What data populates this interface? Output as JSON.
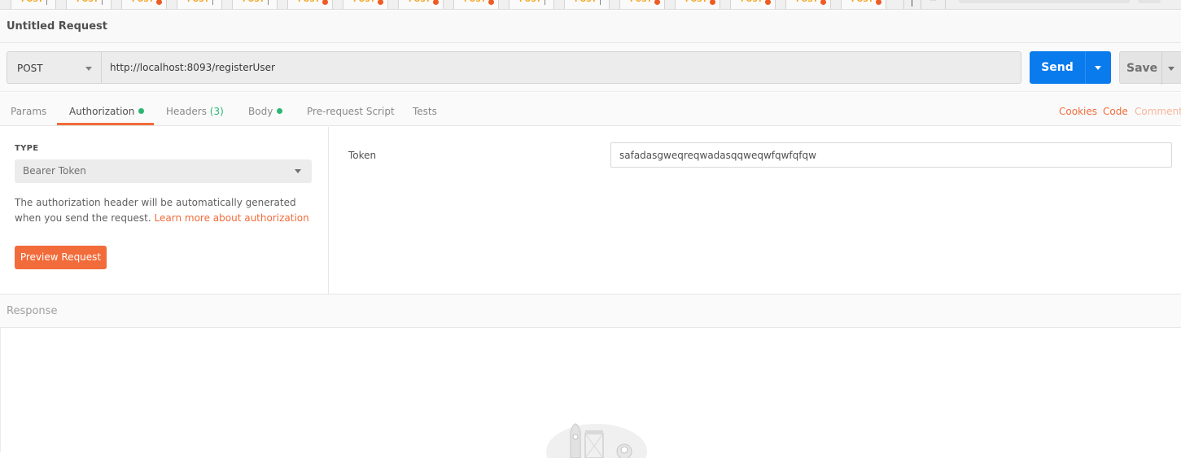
{
  "tabstrip": {
    "tabs": [
      {
        "method": "POST",
        "unsaved": false
      },
      {
        "method": "POST",
        "unsaved": false
      },
      {
        "method": "POST",
        "unsaved": true
      },
      {
        "method": "POST",
        "unsaved": false
      },
      {
        "method": "POST",
        "unsaved": false
      },
      {
        "method": "POST",
        "unsaved": true
      },
      {
        "method": "POST",
        "unsaved": true
      },
      {
        "method": "POST",
        "unsaved": true
      },
      {
        "method": "POST",
        "unsaved": true
      },
      {
        "method": "POST",
        "unsaved": false
      },
      {
        "method": "POST",
        "unsaved": false
      },
      {
        "method": "POST",
        "unsaved": true
      },
      {
        "method": "POST",
        "unsaved": true
      },
      {
        "method": "POST",
        "unsaved": true
      },
      {
        "method": "POST",
        "unsaved": true
      },
      {
        "method": "POST",
        "unsaved": true
      }
    ],
    "more_label": "···"
  },
  "request": {
    "title": "Untitled Request",
    "method": "POST",
    "url": "http://localhost:8093/registerUser",
    "send_label": "Send",
    "save_label": "Save"
  },
  "subtabs": {
    "params": "Params",
    "authorization": "Authorization",
    "headers": "Headers",
    "headers_count": "(3)",
    "body": "Body",
    "prerequest": "Pre-request Script",
    "tests": "Tests",
    "cookies": "Cookies",
    "code": "Code",
    "comments": "Comments"
  },
  "auth": {
    "type_label": "TYPE",
    "type_value": "Bearer Token",
    "description": "The authorization header will be automatically generated when you send the request.",
    "learn_more": "Learn more about authorization",
    "preview_button": "Preview Request",
    "token_label": "Token",
    "token_value": "safadasgweqreqwadasqqweqwfqwfqfqw"
  },
  "response": {
    "title": "Response",
    "illustration_icon": "rocket-launch-icon"
  },
  "colors": {
    "accent_orange": "#f26b3a",
    "send_blue": "#097bed",
    "status_green": "#2bb673",
    "method_post": "#f4a31b"
  }
}
